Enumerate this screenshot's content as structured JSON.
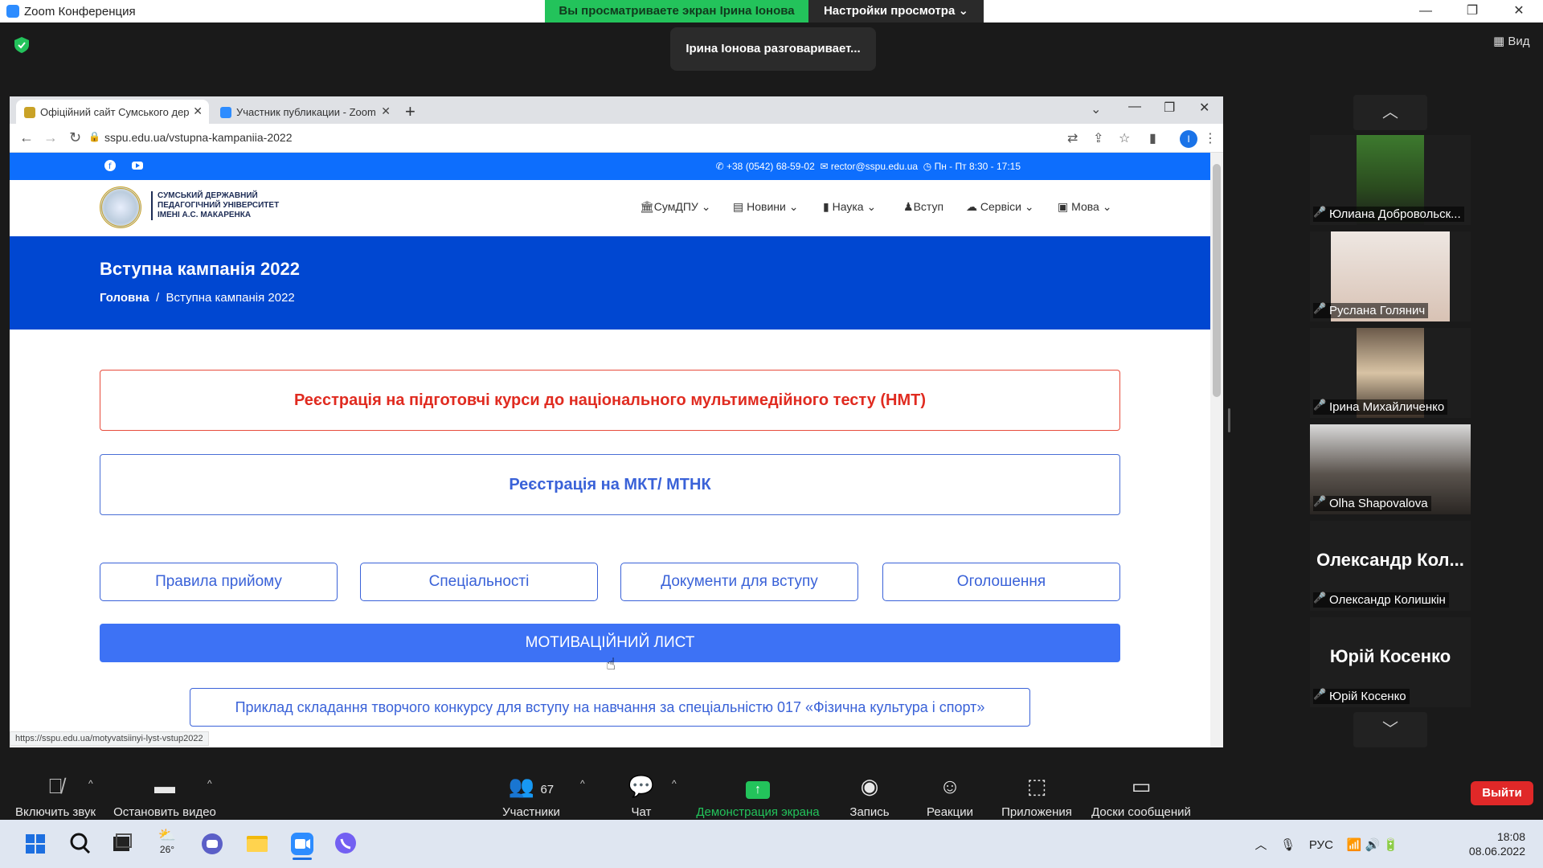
{
  "zoom": {
    "window_title": "Zoom Конференция",
    "share_banner": "Вы просматриваете экран Ірина Іонова",
    "view_settings": "Настройки просмотра",
    "speaking_toast": "Ірина Іонова разговаривает...",
    "view_label": "Вид",
    "controls": {
      "mute": "Включить звук",
      "video": "Остановить видео",
      "participants": "Участники",
      "participants_count": "67",
      "chat": "Чат",
      "share": "Демонстрация экрана",
      "record": "Запись",
      "reactions": "Реакции",
      "apps": "Приложения",
      "whiteboards": "Доски сообщений",
      "leave": "Выйти"
    },
    "gallery": [
      {
        "name": "Юлиана Добровольск..."
      },
      {
        "name": "Руслана Голянич"
      },
      {
        "name": "Ірина Михайличенко"
      },
      {
        "name": "Olha Shapovalova"
      },
      {
        "name": "Олександр Колишкін",
        "display": "Олександр  Кол..."
      },
      {
        "name": "Юрій Косенко",
        "display": "Юрій Косенко"
      }
    ]
  },
  "browser": {
    "tabs": [
      {
        "title": "Офіційний сайт Сумського дер"
      },
      {
        "title": "Участник публикации - Zoom"
      }
    ],
    "url": "sspu.edu.ua/vstupna-kampaniia-2022",
    "profile_initial": "I",
    "status_url": "https://sspu.edu.ua/motyvatsiinyi-lyst-vstup2022"
  },
  "site": {
    "phone": "+38 (0542) 68-59-02",
    "email": "rector@sspu.edu.ua",
    "hours": "Пн - Пт 8:30 - 17:15",
    "logo_lines": [
      "СУМСЬКИЙ ДЕРЖАВНИЙ",
      "ПЕДАГОГІЧНИЙ УНІВЕРСИТЕТ",
      "ІМЕНІ А.С. МАКАРЕНКА"
    ],
    "nav": [
      "СумДПУ",
      "Новини",
      "Наука",
      "Вступ",
      "Сервіси",
      "Мова"
    ],
    "hero_title": "Вступна кампанія 2022",
    "breadcrumb_home": "Головна",
    "breadcrumb_sep": "/",
    "breadcrumb_current": "Вступна кампанія 2022",
    "nmt_registration": "Реєстрація на підготовчі курси до національного мультимедійного тесту (НМТ)",
    "mkt_registration": "Реєстрація на МКТ/ МТНК",
    "links": [
      "Правила прийому",
      "Спеціальності",
      "Документи для вступу",
      "Оголошення"
    ],
    "motivation_letter": "МОТИВАЦІЙНИЙ ЛИСТ",
    "example_link": "Приклад складання творчого конкурсу для вступу на навчання за спеціальністю 017 «Фізична культура і спорт»"
  },
  "taskbar": {
    "weather_temp": "26°",
    "language": "РУС",
    "time": "18:08",
    "date": "08.06.2022"
  },
  "colors": {
    "site_blue": "#0d6efd",
    "hero_blue": "#0047d1",
    "nmt_red": "#e02b20",
    "share_green": "#23c35b",
    "leave_red": "#e02828"
  }
}
